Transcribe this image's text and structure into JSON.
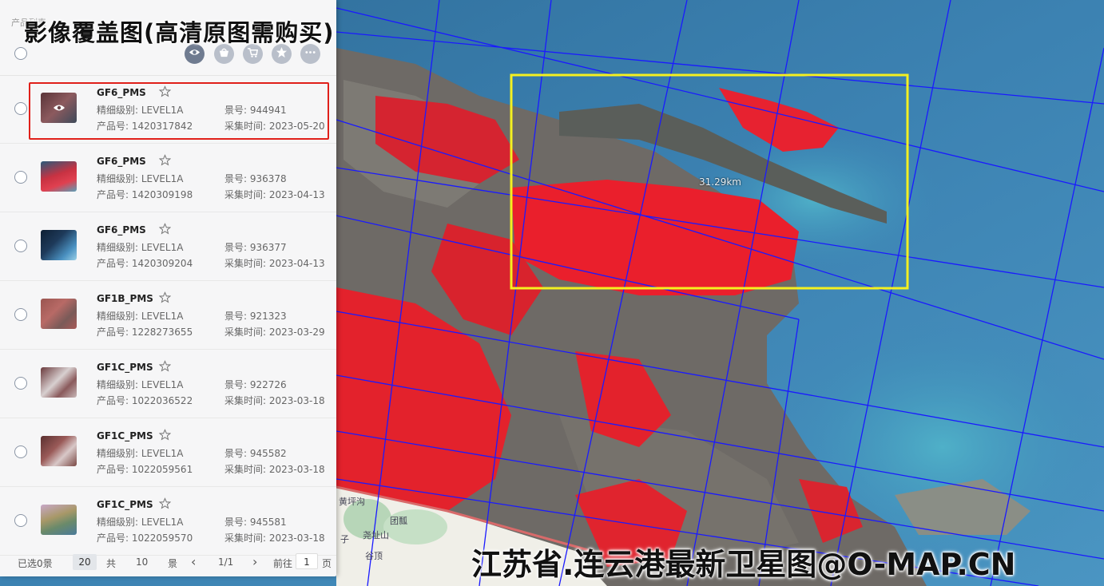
{
  "watermark": {
    "title": "影像覆盖图(高清原图需购买)",
    "bottom": "江苏省.连云港最新卫星图@O-MAP.CN"
  },
  "map": {
    "scale_label": "31.29km",
    "place_labels": [
      "团瓢",
      "尧址山",
      "谷顶",
      "子",
      "黄坪沟"
    ]
  },
  "panel": {
    "tab_label": "产品列表",
    "toolbar_icons": [
      "eye-icon",
      "basket-icon",
      "cart-icon",
      "star-icon",
      "more-icon"
    ],
    "items": [
      {
        "name": "GF6_PMS",
        "level": "精细级别: LEVEL1A",
        "scene": "景号: 944941",
        "product": "产品号: 1420317842",
        "time": "采集时间: 2023-05-20",
        "selected": true,
        "thumb_color": "#7a4a50"
      },
      {
        "name": "GF6_PMS",
        "level": "精细级别: LEVEL1A",
        "scene": "景号: 936378",
        "product": "产品号: 1420309198",
        "time": "采集时间: 2023-04-13",
        "selected": false,
        "thumb_color": "#c83242"
      },
      {
        "name": "GF6_PMS",
        "level": "精细级别: LEVEL1A",
        "scene": "景号: 936377",
        "product": "产品号: 1420309204",
        "time": "采集时间: 2023-04-13",
        "selected": false,
        "thumb_color": "#1e3a5a"
      },
      {
        "name": "GF1B_PMS",
        "level": "精细级别: LEVEL1A",
        "scene": "景号: 921323",
        "product": "产品号: 1228273655",
        "time": "采集时间: 2023-03-29",
        "selected": false,
        "thumb_color": "#a85a58"
      },
      {
        "name": "GF1C_PMS",
        "level": "精细级别: LEVEL1A",
        "scene": "景号: 922726",
        "product": "产品号: 1022036522",
        "time": "采集时间: 2023-03-18",
        "selected": false,
        "thumb_color": "#8a5a5c"
      },
      {
        "name": "GF1C_PMS",
        "level": "精细级别: LEVEL1A",
        "scene": "景号: 945582",
        "product": "产品号: 1022059561",
        "time": "采集时间: 2023-03-18",
        "selected": false,
        "thumb_color": "#7a4844"
      },
      {
        "name": "GF1C_PMS",
        "level": "精细级别: LEVEL1A",
        "scene": "景号: 945581",
        "product": "产品号: 1022059570",
        "time": "采集时间: 2023-03-18",
        "selected": false,
        "thumb_color": "#b8a078"
      }
    ],
    "footer": {
      "selected": "已选0景",
      "page_size": "20",
      "total_label": "共",
      "total": "10",
      "unit": "景",
      "prev": "‹",
      "page_info": "1/1",
      "next": "›",
      "goto_label": "前往",
      "page_input": "1",
      "page_unit": "页"
    }
  },
  "colors": {
    "selection_border": "#e0201a",
    "coverage_box": "#f4f020",
    "grid_lines": "#1a1aff",
    "vegetation": "#e8202a",
    "sea": "#3d80ad"
  }
}
